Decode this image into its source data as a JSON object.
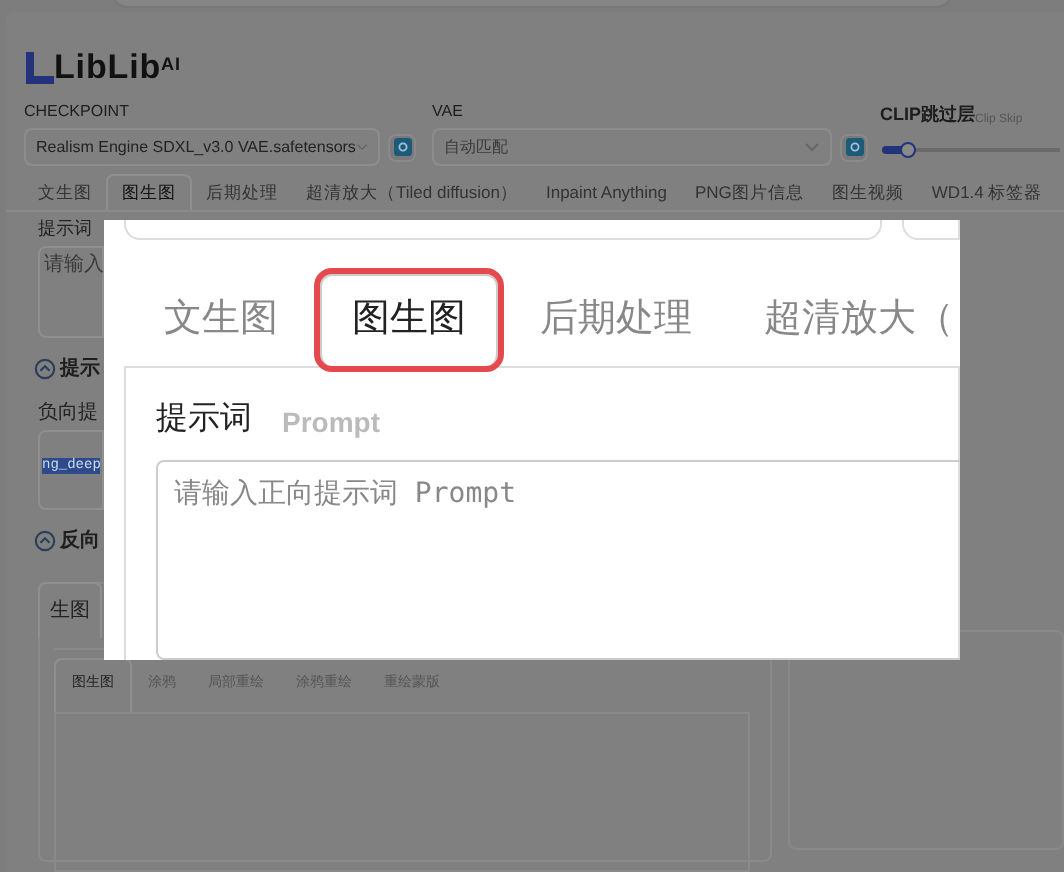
{
  "logo": {
    "text": "LibLib",
    "sup": "AI"
  },
  "checkpoint": {
    "label": "CHECKPOINT",
    "value": "Realism Engine SDXL_v3.0 VAE.safetensors"
  },
  "vae": {
    "label": "VAE",
    "value": "自动匹配"
  },
  "clip_skip": {
    "label": "CLIP跳过层",
    "hint": "Clip Skip",
    "level": 0.15
  },
  "tabs": [
    {
      "label": "文生图",
      "selected": false
    },
    {
      "label": "图生图",
      "selected": true
    },
    {
      "label": "后期处理",
      "selected": false
    },
    {
      "label": "超清放大（Tiled diffusion）",
      "selected": false
    },
    {
      "label": "Inpaint Anything",
      "selected": false
    },
    {
      "label": "PNG图片信息",
      "selected": false
    },
    {
      "label": "图生视频",
      "selected": false
    },
    {
      "label": "WD1.4 标签器",
      "selected": false
    }
  ],
  "prompt": {
    "label": "提示词",
    "placeholder": "请输入"
  },
  "prompt_toggle": {
    "label": "提示"
  },
  "negative": {
    "label": "负向提",
    "value": "ng_deep"
  },
  "negative_toggle": {
    "label": "反向"
  },
  "generate": {
    "tab": "生图",
    "subtabs": [
      {
        "label": "图生图",
        "selected": true
      },
      {
        "label": "涂鸦",
        "selected": false
      },
      {
        "label": "局部重绘",
        "selected": false
      },
      {
        "label": "涂鸦重绘",
        "selected": false
      },
      {
        "label": "重绘蒙版",
        "selected": false
      }
    ]
  },
  "zoom_view": {
    "tabs": [
      {
        "label": "文生图",
        "selected": false,
        "highlighted": false
      },
      {
        "label": "图生图",
        "selected": true,
        "highlighted": true
      },
      {
        "label": "后期处理",
        "selected": false,
        "highlighted": false
      },
      {
        "label": "超清放大（",
        "selected": false,
        "highlighted": false
      }
    ],
    "prompt_label": "提示词",
    "prompt_hint": "Prompt",
    "placeholder": "请输入正向提示词 Prompt"
  }
}
